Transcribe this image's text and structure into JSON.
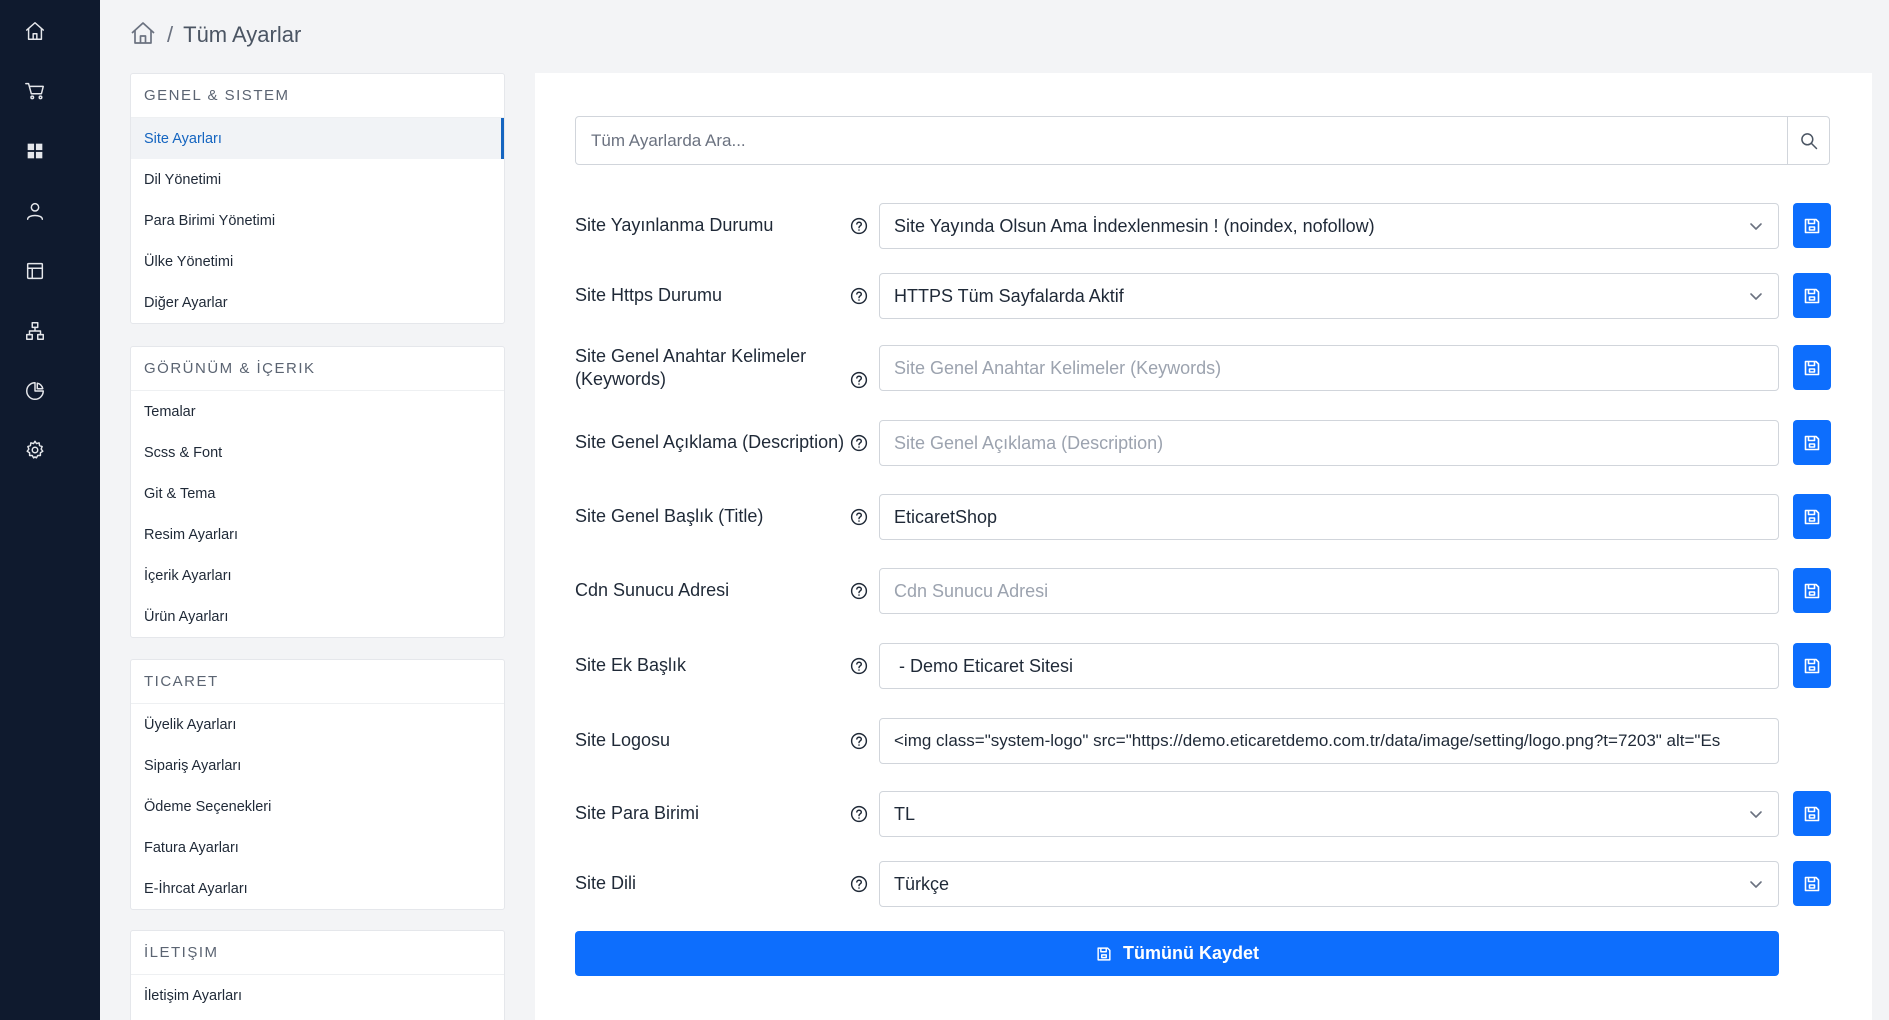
{
  "rail": {
    "icons": [
      "home-icon",
      "cart-icon",
      "grid-icon",
      "user-icon",
      "layout-icon",
      "sitemap-icon",
      "pie-chart-icon",
      "gear-icon"
    ]
  },
  "breadcrumb": {
    "separator": "/",
    "title": "Tüm Ayarlar"
  },
  "sidebar": {
    "sections": [
      {
        "heading": "GENEL & SISTEM",
        "items": [
          "Site Ayarları",
          "Dil Yönetimi",
          "Para Birimi Yönetimi",
          "Ülke Yönetimi",
          "Diğer Ayarlar"
        ]
      },
      {
        "heading": "GÖRÜNÜM & İÇERIK",
        "items": [
          "Temalar",
          "Scss & Font",
          "Git & Tema",
          "Resim Ayarları",
          "İçerik Ayarları",
          "Ürün Ayarları"
        ]
      },
      {
        "heading": "TICARET",
        "items": [
          "Üyelik Ayarları",
          "Sipariş Ayarları",
          "Ödeme Seçenekleri",
          "Fatura Ayarları",
          "E-İhrcat Ayarları"
        ]
      },
      {
        "heading": "İLETIŞIM",
        "items": [
          "İletişim Ayarları"
        ]
      }
    ],
    "active_item": "Site Ayarları"
  },
  "search": {
    "placeholder": "Tüm Ayarlarda Ara..."
  },
  "settings": [
    {
      "label": "Site Yayınlanma Durumu",
      "type": "select",
      "value": "Site Yayında Olsun Ama İndexlenmesin ! (noindex, nofollow)",
      "placeholder": ""
    },
    {
      "label": "Site Https Durumu",
      "type": "select",
      "value": "HTTPS Tüm Sayfalarda Aktif",
      "placeholder": ""
    },
    {
      "label": "Site Genel Anahtar Kelimeler (Keywords)",
      "type": "input",
      "value": "",
      "placeholder": "Site Genel Anahtar Kelimeler (Keywords)"
    },
    {
      "label": "Site Genel Açıklama (Description)",
      "type": "input",
      "value": "",
      "placeholder": "Site Genel Açıklama (Description)"
    },
    {
      "label": "Site Genel Başlık (Title)",
      "type": "input",
      "value": "EticaretShop",
      "placeholder": ""
    },
    {
      "label": "Cdn Sunucu Adresi",
      "type": "input",
      "value": "",
      "placeholder": "Cdn Sunucu Adresi"
    },
    {
      "label": "Site Ek Başlık",
      "type": "input",
      "value": " - Demo Eticaret Sitesi",
      "placeholder": ""
    },
    {
      "label": "Site Logosu",
      "type": "input",
      "value": "<img class=\"system-logo\" src=\"https://demo.eticaretdemo.com.tr/data/image/setting/logo.png?t=7203\" alt=\"Es",
      "placeholder": ""
    },
    {
      "label": "Site Para Birimi",
      "type": "select",
      "value": "TL",
      "placeholder": ""
    },
    {
      "label": "Site Dili",
      "type": "select",
      "value": "Türkçe",
      "placeholder": ""
    }
  ],
  "save_all_label": "Tümünü Kaydet",
  "colors": {
    "rail_bg": "#0f1a2e",
    "accent": "#0d6efd",
    "active_link": "#1565c0"
  }
}
